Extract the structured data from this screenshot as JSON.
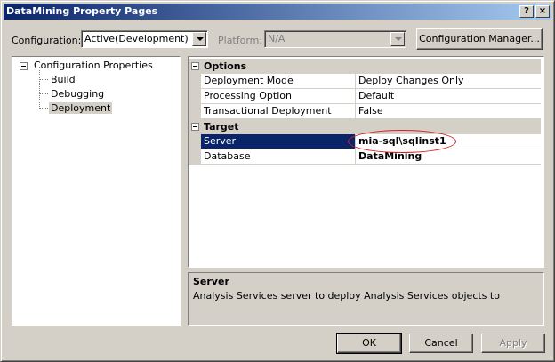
{
  "window": {
    "title": "DataMining Property Pages",
    "help_glyph": "?",
    "close_glyph": "×"
  },
  "toolbar": {
    "configuration_label": "Configuration:",
    "configuration_value": "Active(Development)",
    "platform_label": "Platform:",
    "platform_value": "N/A",
    "config_manager_label": "Configuration Manager..."
  },
  "tree": {
    "root": "Configuration Properties",
    "children": [
      "Build",
      "Debugging",
      "Deployment"
    ],
    "selected": "Deployment"
  },
  "property_grid": {
    "categories": [
      {
        "name": "Options",
        "rows": [
          {
            "name": "Deployment Mode",
            "value": "Deploy Changes Only"
          },
          {
            "name": "Processing Option",
            "value": "Default"
          },
          {
            "name": "Transactional Deployment",
            "value": "False"
          }
        ]
      },
      {
        "name": "Target",
        "rows": [
          {
            "name": "Server",
            "value": "mia-sql\\sqlinst1"
          },
          {
            "name": "Database",
            "value": "DataMining"
          }
        ]
      }
    ],
    "selected_row": "Server"
  },
  "description": {
    "title": "Server",
    "text": "Analysis Services server to deploy Analysis Services objects to"
  },
  "buttons": {
    "ok": "OK",
    "cancel": "Cancel",
    "apply": "Apply"
  },
  "colors": {
    "title_bar": "#0a246a",
    "selection": "#0a246a",
    "annotation": "#d02020",
    "face": "#d4d0c8"
  }
}
